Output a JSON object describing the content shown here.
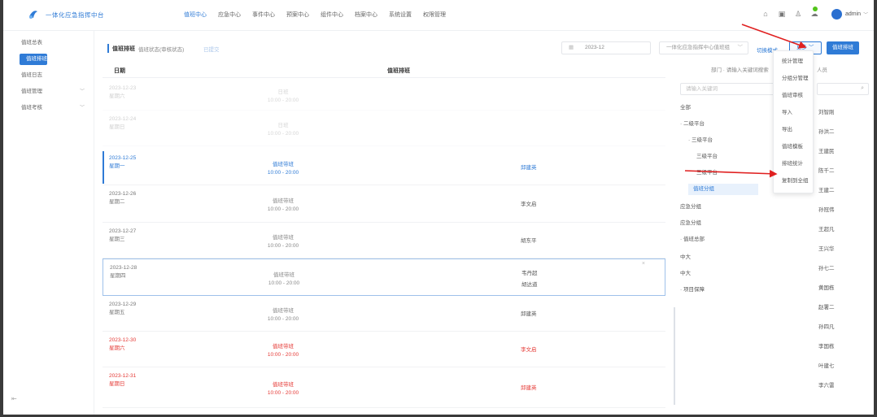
{
  "header": {
    "brand": "一体化应急指挥中台",
    "nav": [
      "值班中心",
      "应急中心",
      "事件中心",
      "预案中心",
      "组件中心",
      "档案中心",
      "系统设置",
      "权限管理"
    ],
    "active_nav": 0,
    "user": "admin",
    "icons": [
      "home-icon",
      "calendar-icon",
      "user-icon",
      "notification-icon"
    ],
    "accent": "#2f7bd6"
  },
  "sidebar": {
    "items": [
      {
        "label": "值班总表",
        "active": false,
        "caret": false
      },
      {
        "label": "值班排班",
        "active": true,
        "caret": false
      },
      {
        "label": "值班日志",
        "active": false,
        "caret": false
      },
      {
        "label": "值班管理",
        "active": false,
        "caret": true
      },
      {
        "label": "值班考核",
        "active": false,
        "caret": true
      }
    ]
  },
  "toolbar": {
    "title": "值班排班",
    "status_label": "值班状态(审核状态)",
    "status_value": "已提交",
    "date": "2023-12",
    "org_placeholder": "一体化应急指挥中心值班组",
    "text_btn": "切换模式",
    "more_btn": "更多",
    "primary_btn": "值班排班"
  },
  "table": {
    "columns": [
      "日期",
      "值班排班"
    ],
    "rows": [
      {
        "date": "2023-12-23",
        "weekday": "星期六",
        "shift": "日班",
        "time": "10:00 - 20:00",
        "persons": [],
        "style": "faded"
      },
      {
        "date": "2023-12-24",
        "weekday": "星期日",
        "shift": "日班",
        "time": "10:00 - 20:00",
        "persons": [],
        "style": "faded"
      },
      {
        "date": "2023-12-25",
        "weekday": "星期一",
        "shift": "值班带班",
        "time": "10:00 - 20:00",
        "persons": [
          "邱建英"
        ],
        "style": "blue"
      },
      {
        "date": "2023-12-26",
        "weekday": "星期二",
        "shift": "值班带班",
        "time": "10:00 - 20:00",
        "persons": [
          "李文启"
        ],
        "style": "normal"
      },
      {
        "date": "2023-12-27",
        "weekday": "星期三",
        "shift": "值班带班",
        "time": "10:00 - 20:00",
        "persons": [
          "胡东平"
        ],
        "style": "normal"
      },
      {
        "date": "2023-12-28",
        "weekday": "星期四",
        "shift": "值班带班",
        "time": "10:00 - 20:00",
        "persons": [
          "韦丹超",
          "胡达道"
        ],
        "style": "highlight"
      },
      {
        "date": "2023-12-29",
        "weekday": "星期五",
        "shift": "值班带班",
        "time": "10:00 - 20:00",
        "persons": [
          "邱建英"
        ],
        "style": "normal"
      },
      {
        "date": "2023-12-30",
        "weekday": "星期六",
        "shift": "值班带班",
        "time": "10:00 - 20:00",
        "persons": [
          "李文启"
        ],
        "style": "red"
      },
      {
        "date": "2023-12-31",
        "weekday": "星期日",
        "shift": "值班带班",
        "time": "10:00 - 20:00",
        "persons": [
          "邱建英"
        ],
        "style": "red"
      }
    ]
  },
  "tree": {
    "header": "部门 · 请输入关键词搜索",
    "search_placeholder": "请输入关键词",
    "nodes": [
      {
        "label": "全部",
        "indent": 0
      },
      {
        "label": "· 二级平台",
        "indent": 0
      },
      {
        "label": "· 三级平台",
        "indent": 1
      },
      {
        "label": "三级平台",
        "indent": 2
      },
      {
        "label": "三级平台",
        "indent": 2
      },
      {
        "label": "值班分组",
        "indent": 1,
        "selected": true
      },
      {
        "label": "应急分组",
        "indent": 0
      },
      {
        "label": "应急分组",
        "indent": 0
      },
      {
        "label": "· 值班总部",
        "indent": 0
      },
      {
        "label": "中大",
        "indent": 0
      },
      {
        "label": "中大",
        "indent": 0
      },
      {
        "label": "· 项目保障",
        "indent": 0
      }
    ],
    "name_header": "人员",
    "names": [
      "刘智刚",
      "孙洪二",
      "王建民",
      "陈千二",
      "王建二",
      "孙冠伟",
      "王超凡",
      "王兴华",
      "孙七二",
      "黄国栋",
      "赵署二",
      "孙四凡",
      "李国栋",
      "叶建七",
      "李六雷"
    ]
  },
  "menu": {
    "items": [
      "统计管理",
      "分组分管理",
      "值班审核",
      "导入",
      "导出",
      "值班模板",
      "排班统计",
      "复制到全组"
    ]
  },
  "annotations": {
    "arrow_color": "#e02020"
  }
}
